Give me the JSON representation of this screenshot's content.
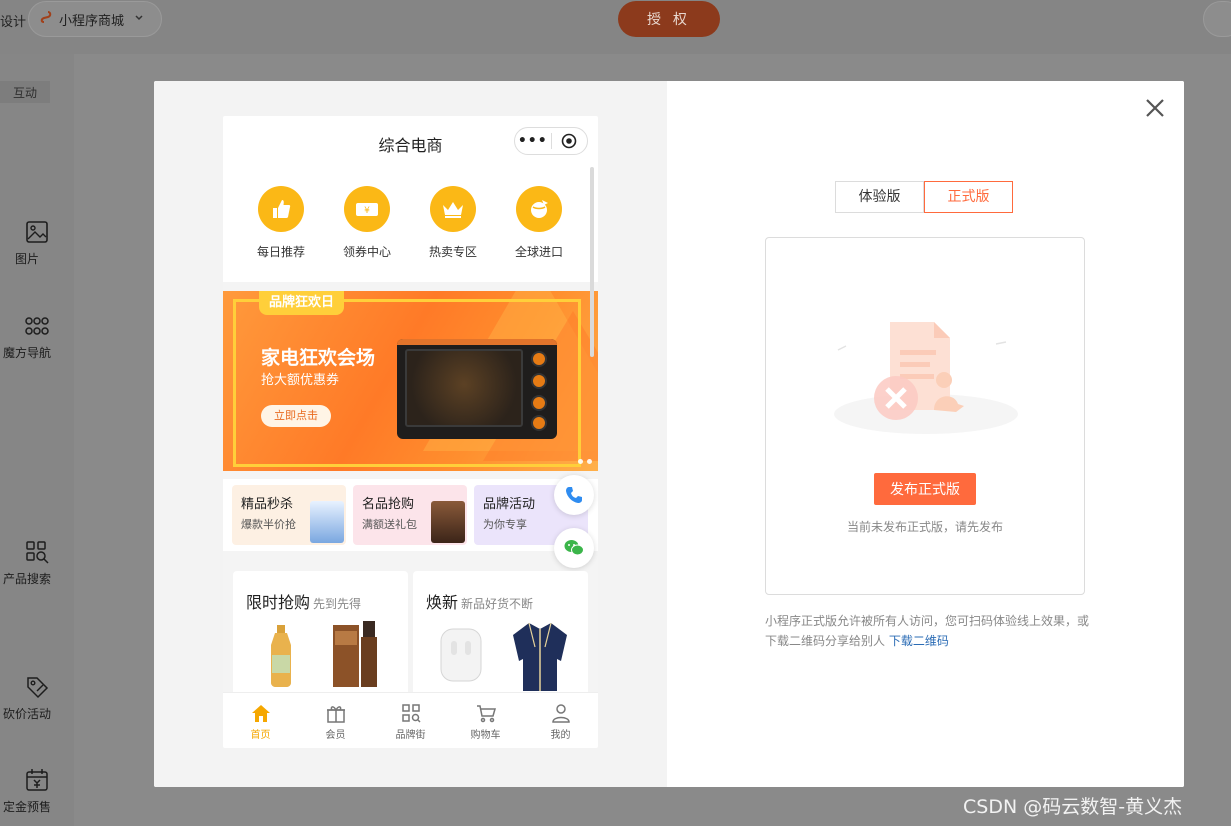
{
  "topbar": {
    "design_label": "设计",
    "store_name": "小程序商城",
    "auth_label": "授 权"
  },
  "sidebar": {
    "tag": "互动",
    "items": [
      {
        "label": "图片",
        "icon": "image-icon"
      },
      {
        "label": "魔方导航",
        "icon": "grid-dots-icon"
      },
      {
        "label": "产品搜索",
        "icon": "search-grid-icon"
      },
      {
        "label": "砍价活动",
        "icon": "tag-icon"
      },
      {
        "label": "定金预售",
        "icon": "calendar-yen-icon"
      }
    ]
  },
  "phone": {
    "title": "综合电商",
    "quick_links": [
      "每日推荐",
      "领券中心",
      "热卖专区",
      "全球进口"
    ],
    "banner": {
      "tag": "品牌狂欢日",
      "headline": "家电狂欢会场",
      "subline": "抢大额优惠券",
      "cta": "立即点击"
    },
    "promos": [
      {
        "title": "精品秒杀",
        "sub": "爆款半价抢"
      },
      {
        "title": "名品抢购",
        "sub": "满额送礼包"
      },
      {
        "title": "品牌活动",
        "sub": "为你专享"
      }
    ],
    "sale_cards": [
      {
        "title": "限时抢购",
        "sub": "先到先得"
      },
      {
        "title": "焕新",
        "sub": "新品好货不断"
      }
    ],
    "tabs": [
      "首页",
      "会员",
      "品牌街",
      "购物车",
      "我的"
    ]
  },
  "right": {
    "segments": [
      "体验版",
      "正式版"
    ],
    "active_segment": "正式版",
    "publish_btn": "发布正式版",
    "empty_note": "当前未发布正式版，请先发布",
    "desc": "小程序正式版允许被所有人访问，您可扫码体验线上效果，或下载二维码分享给别人",
    "desc_link": "下载二维码"
  },
  "watermark": "CSDN @码云数智-黄义杰",
  "colors": {
    "accent": "#ff6a3d",
    "yellow": "#fbb816",
    "link": "#2b6cb5"
  }
}
